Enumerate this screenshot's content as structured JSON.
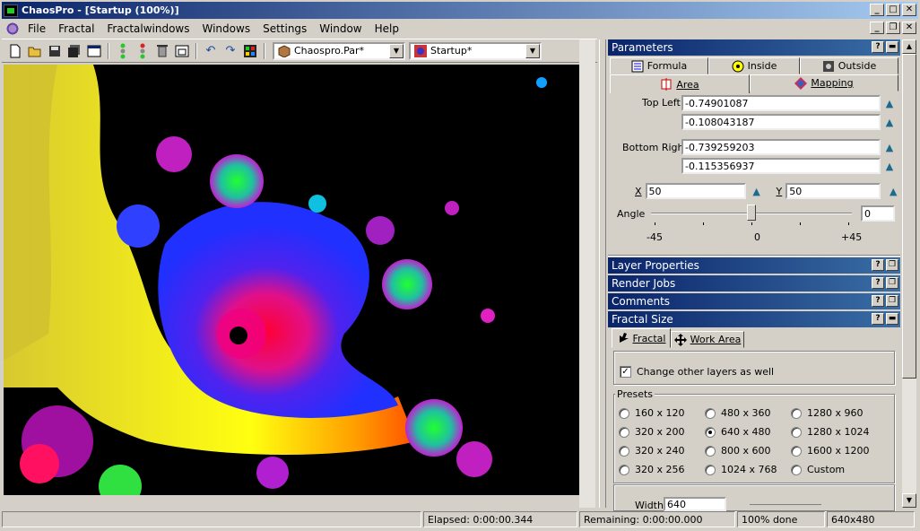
{
  "window": {
    "title": "ChaosPro - [Startup (100%)]",
    "minimize": "_",
    "maximize": "□",
    "close": "✕"
  },
  "menu": [
    "File",
    "Fractal",
    "Fractalwindows",
    "Windows",
    "Settings",
    "Window",
    "Help"
  ],
  "toolbar": {
    "param_combo": "Chaospro.Par*",
    "layer_combo": "Startup*"
  },
  "parameters": {
    "title": "Parameters",
    "tabs": {
      "formula": "Formula",
      "inside": "Inside",
      "outside": "Outside",
      "area": "Area",
      "mapping": "Mapping"
    },
    "top_left_label": "Top Left",
    "top_left_x": "-0.74901087",
    "top_left_y": "-0.108043187",
    "bottom_right_label": "Bottom Right",
    "bottom_right_x": "-0.739259203",
    "bottom_right_y": "-0.115356937",
    "x_label": "X",
    "x_value": "50",
    "y_label": "Y",
    "y_value": "50",
    "angle_label": "Angle",
    "angle_value": "0",
    "angle_min": "-45",
    "angle_mid": "0",
    "angle_max": "+45",
    "angle_fraction": 0.5
  },
  "sections": {
    "layer_properties": "Layer Properties",
    "render_jobs": "Render Jobs",
    "comments": "Comments",
    "fractal_size": "Fractal Size"
  },
  "fractal_size": {
    "tab_fractal": "Fractal",
    "tab_work_area": "Work Area",
    "change_layers": "Change other layers as well",
    "presets_title": "Presets",
    "presets": [
      [
        "160 x 120",
        "480 x 360",
        "1280 x 960"
      ],
      [
        "320 x 200",
        "640 x 480",
        "1280 x 1024"
      ],
      [
        "320 x 240",
        "800 x 600",
        "1600 x 1200"
      ],
      [
        "320 x 256",
        "1024 x 768",
        "Custom"
      ]
    ],
    "selected": "640 x 480",
    "width_label": "Width",
    "width_value": "640"
  },
  "status": {
    "elapsed": "Elapsed: 0:00:00.344",
    "remaining": "Remaining: 0:00:00.000",
    "done": "100% done",
    "size": "640x480"
  },
  "colors": {
    "title_start": "#0a246a",
    "title_end": "#a6caf0",
    "face": "#d4d0c8",
    "lock": "#1a6b8c"
  },
  "icons": [
    "app-icon",
    "new-icon",
    "open-icon",
    "save-icon",
    "save-all-icon",
    "window-icon",
    "traffic-green-icon",
    "traffic-red-icon",
    "trash-icon",
    "layers-icon",
    "undo-icon",
    "redo-icon",
    "palette-icon"
  ]
}
